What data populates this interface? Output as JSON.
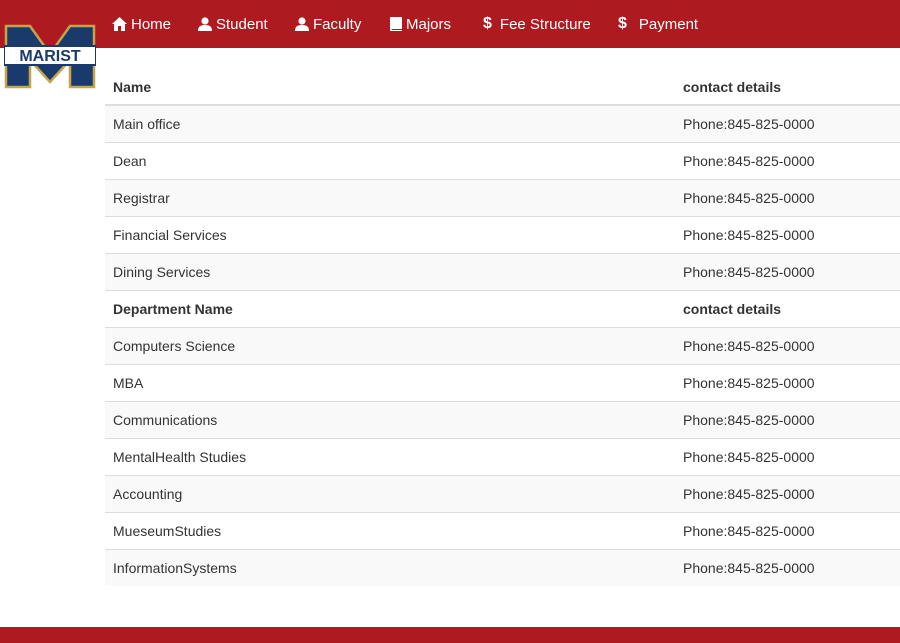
{
  "brand": {
    "logo_text": "MARIST",
    "colors": {
      "nav": "#ad1b20",
      "logo_blue": "#1a3a6c",
      "logo_gold": "#c6a44a"
    }
  },
  "nav": {
    "items": [
      {
        "label": "Home",
        "icon": "home-icon"
      },
      {
        "label": "Student",
        "icon": "user-icon"
      },
      {
        "label": "Faculty",
        "icon": "user-icon"
      },
      {
        "label": "Majors",
        "icon": "book-icon"
      },
      {
        "label": "Fee Structure",
        "icon": "dollar-icon"
      },
      {
        "label": "Payment",
        "icon": "dollar-icon"
      }
    ],
    "dollar_glyph": "$"
  },
  "offices": {
    "headers": [
      "Name",
      "contact details"
    ],
    "rows": [
      [
        "Main office",
        "Phone:845-825-0000"
      ],
      [
        "Dean",
        "Phone:845-825-0000"
      ],
      [
        "Registrar",
        "Phone:845-825-0000"
      ],
      [
        "Financial Services",
        "Phone:845-825-0000"
      ],
      [
        "Dining Services",
        "Phone:845-825-0000"
      ]
    ]
  },
  "departments": {
    "headers": [
      "Department Name",
      "contact details"
    ],
    "rows": [
      [
        "Computers Science",
        "Phone:845-825-0000"
      ],
      [
        "MBA",
        "Phone:845-825-0000"
      ],
      [
        "Communications",
        "Phone:845-825-0000"
      ],
      [
        "MentalHealth Studies",
        "Phone:845-825-0000"
      ],
      [
        "Accounting",
        "Phone:845-825-0000"
      ],
      [
        "MueseumStudies",
        "Phone:845-825-0000"
      ],
      [
        "InformationSystems",
        "Phone:845-825-0000"
      ]
    ]
  }
}
